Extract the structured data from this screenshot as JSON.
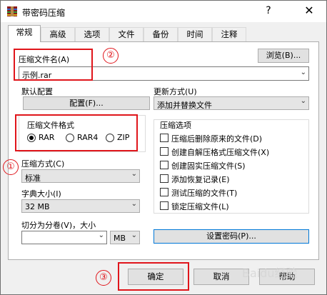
{
  "window": {
    "title": "带密码压缩",
    "help_glyph": "?",
    "close_glyph": "✕"
  },
  "tabs": [
    "常规",
    "高级",
    "选项",
    "文件",
    "备份",
    "时间",
    "注释"
  ],
  "archive": {
    "name_label": "压缩文件名(A)",
    "name_value": "示例.rar",
    "browse_label": "浏览(B)..."
  },
  "profile": {
    "label": "默认配置",
    "button": "配置(F)..."
  },
  "update_mode": {
    "label": "更新方式(U)",
    "value": "添加并替换文件"
  },
  "format": {
    "label": "压缩文件格式",
    "options": [
      "RAR",
      "RAR4",
      "ZIP"
    ],
    "selected": "RAR"
  },
  "method": {
    "label": "压缩方式(C)",
    "value": "标准"
  },
  "dict": {
    "label": "字典大小(I)",
    "value": "32 MB"
  },
  "split": {
    "label": "切分为分卷(V)，大小",
    "value": "",
    "unit": "MB"
  },
  "options": {
    "label": "压缩选项",
    "items": [
      "压缩后删除原来的文件(D)",
      "创建自解压格式压缩文件(X)",
      "创建固实压缩文件(S)",
      "添加恢复记录(E)",
      "测试压缩的文件(T)",
      "锁定压缩文件(L)"
    ]
  },
  "password_button": "设置密码(P)...",
  "buttons": {
    "ok": "确定",
    "cancel": "取消",
    "help": "帮助"
  },
  "annotations": {
    "one": "①",
    "two": "②",
    "three": "③"
  },
  "watermark": "Baidu经验",
  "colors": {
    "annotation_red": "#e0151b",
    "focus_blue": "#0078d7"
  }
}
